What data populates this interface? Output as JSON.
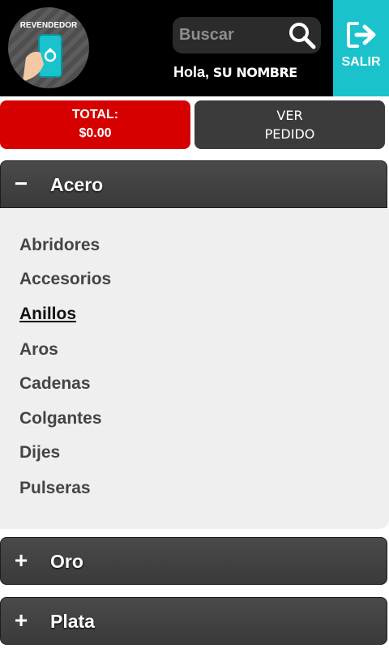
{
  "header": {
    "logo_text": "REVENDEDOR",
    "search_placeholder": "Buscar",
    "greeting_hi": "Hola,",
    "greeting_name": "SU NOMBRE",
    "logout_label": "SALIR",
    "icons": {
      "search": "search-icon",
      "logout": "logout-icon"
    },
    "colors": {
      "logout_bg": "#1ac2cc"
    }
  },
  "actions": {
    "total_line1": "TOTAL:",
    "total_line2": "$0.00",
    "order_line1": "VER",
    "order_line2": "PEDIDO",
    "colors": {
      "total_bg": "#d60000",
      "order_bg": "#3b3b3b"
    }
  },
  "categories": [
    {
      "sign": "−",
      "title": "Acero",
      "expanded": true,
      "items": [
        "Abridores",
        "Accesorios",
        "Anillos",
        "Aros",
        "Cadenas",
        "Colgantes",
        "Dijes",
        "Pulseras"
      ],
      "active_item": "Anillos"
    },
    {
      "sign": "+",
      "title": "Oro",
      "expanded": false
    },
    {
      "sign": "+",
      "title": "Plata",
      "expanded": false
    }
  ]
}
